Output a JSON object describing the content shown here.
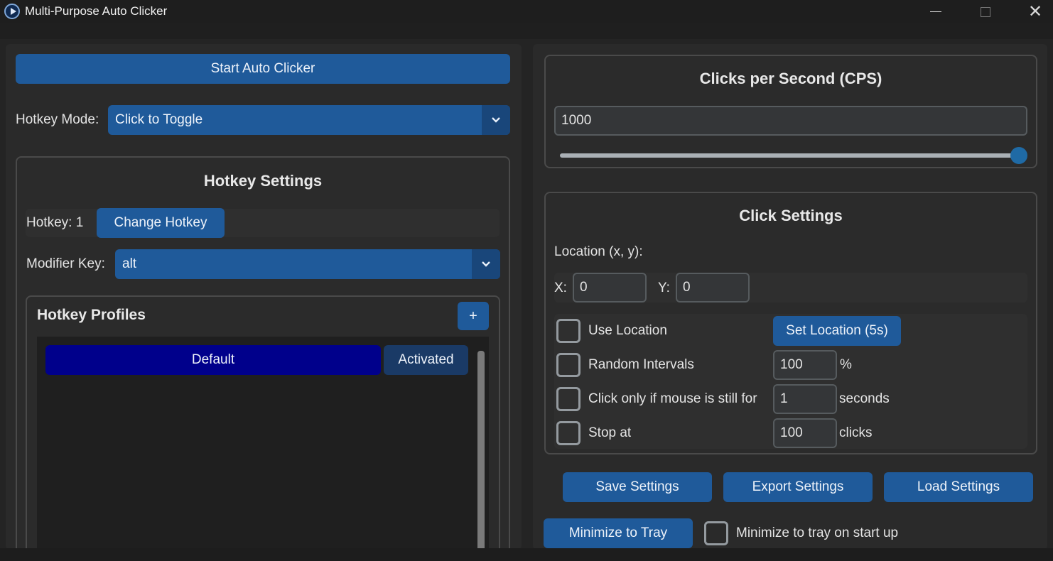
{
  "window": {
    "title": "Multi-Purpose Auto Clicker"
  },
  "left": {
    "start_button": "Start Auto Clicker",
    "hotkey_mode": {
      "label": "Hotkey Mode:",
      "value": "Click to Toggle"
    },
    "hotkey_settings": {
      "title": "Hotkey Settings",
      "hotkey_label": "Hotkey: 1",
      "change_hotkey": "Change Hotkey",
      "modifier_label": "Modifier Key:",
      "modifier_value": "alt"
    },
    "profiles": {
      "title": "Hotkey Profiles",
      "add_button": "+",
      "items": [
        {
          "name": "Default",
          "status": "Activated"
        }
      ]
    }
  },
  "right": {
    "cps": {
      "title": "Clicks per Second (CPS)",
      "value": "1000",
      "slider_fraction": 1.0
    },
    "click_settings": {
      "title": "Click Settings",
      "location_label": "Location (x, y):",
      "x_label": "X:",
      "x_value": "0",
      "y_label": "Y:",
      "y_value": "0",
      "use_location": "Use Location",
      "set_location": "Set Location (5s)",
      "random_intervals": "Random Intervals",
      "random_value": "100",
      "random_unit": "%",
      "mouse_still": "Click only if mouse is still for",
      "mouse_still_value": "1",
      "mouse_still_unit": "seconds",
      "stop_at": "Stop at",
      "stop_at_value": "100",
      "stop_at_unit": "clicks"
    },
    "save_settings": "Save Settings",
    "export_settings": "Export Settings",
    "load_settings": "Load Settings",
    "minimize_to_tray": "Minimize to Tray",
    "minimize_on_startup": "Minimize to tray on start up"
  },
  "colors": {
    "accent": "#1f5a9a",
    "profile_default": "#00008b",
    "profile_status": "#1a3a66",
    "background": "#242424"
  },
  "icons": [
    "app-icon",
    "chevron-down-icon",
    "minimize-icon",
    "maximize-icon",
    "close-icon"
  ]
}
